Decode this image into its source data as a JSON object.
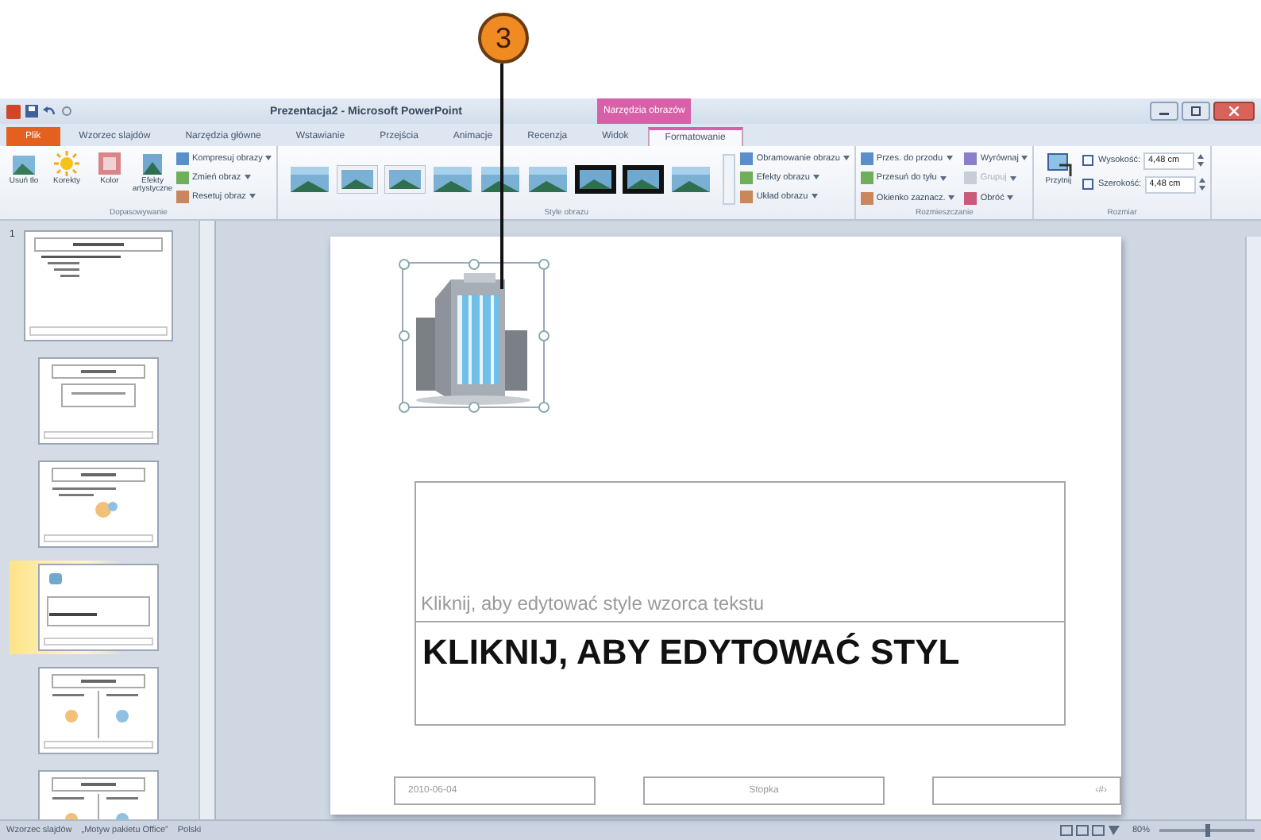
{
  "callout": {
    "label": "3"
  },
  "window": {
    "title": "Prezentacja2 - Microsoft PowerPoint",
    "context_group": "Narzędzia obrazów"
  },
  "tabs": [
    {
      "label": "Plik",
      "kind": "file",
      "selected": false
    },
    {
      "label": "Wzorzec slajdów",
      "kind": "normal",
      "selected": false
    },
    {
      "label": "Narzędzia główne",
      "kind": "normal",
      "selected": false
    },
    {
      "label": "Wstawianie",
      "kind": "normal",
      "selected": false
    },
    {
      "label": "Przejścia",
      "kind": "normal",
      "selected": false
    },
    {
      "label": "Animacje",
      "kind": "normal",
      "selected": false
    },
    {
      "label": "Recenzja",
      "kind": "normal",
      "selected": false
    },
    {
      "label": "Widok",
      "kind": "normal",
      "selected": false
    },
    {
      "label": "Formatowanie",
      "kind": "context",
      "selected": true
    }
  ],
  "ribbon": {
    "groups": [
      {
        "title": "Dopasowywanie",
        "large_buttons": [
          {
            "label": "Usuń tło",
            "kind": "removebg"
          },
          {
            "label": "Korekty",
            "kind": "sun"
          },
          {
            "label": "Kolor",
            "kind": "color"
          },
          {
            "label": "Efekty artystyczne",
            "kind": "art"
          }
        ],
        "small_buttons": [
          {
            "label": "Kompresuj obrazy",
            "disabled": false
          },
          {
            "label": "Zmień obraz",
            "disabled": false
          },
          {
            "label": "Resetuj obraz",
            "disabled": false
          }
        ]
      },
      {
        "title": "Style obrazu",
        "gallery": [
          {
            "kind": "soft"
          },
          {
            "kind": "frame"
          },
          {
            "kind": "frame"
          },
          {
            "kind": "soft"
          },
          {
            "kind": "soft"
          },
          {
            "kind": "soft"
          },
          {
            "kind": "black"
          },
          {
            "kind": "black"
          },
          {
            "kind": "soft"
          }
        ],
        "small_buttons": [
          {
            "label": "Obramowanie obrazu",
            "disabled": false
          },
          {
            "label": "Efekty obrazu",
            "disabled": false
          },
          {
            "label": "Układ obrazu",
            "disabled": false
          }
        ]
      },
      {
        "title": "Rozmieszczanie",
        "small_buttons": [
          {
            "label": "Przes. do przodu",
            "disabled": false
          },
          {
            "label": "Przesuń do tyłu",
            "disabled": false
          },
          {
            "label": "Okienko zaznacz.",
            "disabled": false
          },
          {
            "label": "Wyrównaj",
            "disabled": false
          },
          {
            "label": "Grupuj",
            "disabled": true
          },
          {
            "label": "Obróć",
            "disabled": false
          }
        ]
      },
      {
        "title": "Rozmiar",
        "large_buttons": [
          {
            "label": "Przytnij",
            "kind": "crop"
          }
        ],
        "fields": [
          {
            "label": "Wysokość:",
            "value": "4,48 cm"
          },
          {
            "label": "Szerokość:",
            "value": "4,48 cm"
          }
        ]
      }
    ]
  },
  "slides": [
    {
      "number": "1",
      "kind": "master",
      "selected": false
    },
    {
      "kind": "title",
      "selected": false
    },
    {
      "kind": "content",
      "selected": false
    },
    {
      "kind": "section",
      "selected": true
    },
    {
      "kind": "two",
      "selected": false
    },
    {
      "kind": "two",
      "selected": false
    }
  ],
  "slide": {
    "picture": {
      "selected": true
    },
    "subtitle": "Kliknij, aby edytować style wzorca tekstu",
    "title": "KLIKNIJ, ABY EDYTOWAĆ STYL",
    "footers": [
      "2010-06-04",
      "Stopka",
      "‹#›"
    ]
  },
  "status_bar": {
    "items": [
      "Wzorzec slajdów",
      "„Motyw pakietu Office”",
      "Polski"
    ],
    "zoom": "80%",
    "zoom_slider": {
      "level": 0.5
    }
  }
}
